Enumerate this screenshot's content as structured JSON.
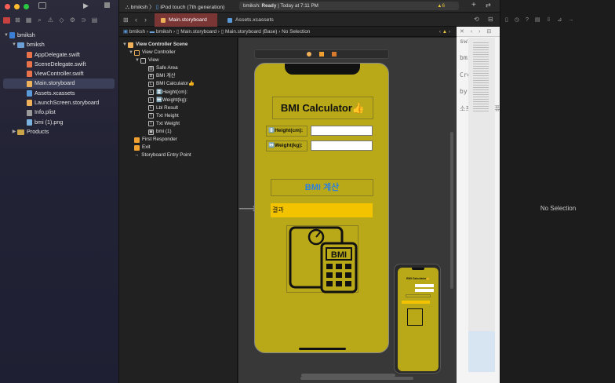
{
  "project": {
    "name": "bmiksh",
    "group": "bmiksh",
    "files": [
      {
        "label": "AppDelegate.swift",
        "kind": "swift"
      },
      {
        "label": "SceneDelegate.swift",
        "kind": "swift"
      },
      {
        "label": "ViewController.swift",
        "kind": "swift"
      },
      {
        "label": "Main.storyboard",
        "kind": "storyboard",
        "selected": true
      },
      {
        "label": "Assets.xcassets",
        "kind": "assets"
      },
      {
        "label": "LaunchScreen.storyboard",
        "kind": "storyboard"
      },
      {
        "label": "Info.plist",
        "kind": "plist"
      },
      {
        "label": "bmi (1).png",
        "kind": "image"
      }
    ],
    "products": "Products"
  },
  "toolbar": {
    "scheme": "bmiksh",
    "device": "iPod touch (7th generation)",
    "status_app": "bmiksh:",
    "status_state": "Ready",
    "status_time": "Today at 7:11 PM",
    "warning_count": "6"
  },
  "tabs": [
    {
      "label": "Main.storyboard",
      "active": true
    },
    {
      "label": "Assets.xcassets",
      "active": false
    }
  ],
  "jumpbar": {
    "items": [
      "bmiksh",
      "bmiksh",
      "Main.storyboard",
      "Main.storyboard (Base)",
      "No Selection"
    ]
  },
  "outline": {
    "scene": "View Controller Scene",
    "controller": "View Controller",
    "view": "View",
    "children": [
      {
        "icon": "▥",
        "label": "Safe Area"
      },
      {
        "icon": "B",
        "label": "BMI 계산"
      },
      {
        "icon": "L",
        "label": "BMI Calculator👍"
      },
      {
        "icon": "L",
        "label": "↕️Height(cm):"
      },
      {
        "icon": "L",
        "label": "↔️Weight(kg):"
      },
      {
        "icon": "L",
        "label": "Lbl Result"
      },
      {
        "icon": "T",
        "label": "Txt Height"
      },
      {
        "icon": "T",
        "label": "Txt Weight"
      },
      {
        "icon": "▣",
        "label": "bmi (1)"
      }
    ],
    "first_responder": "First Responder",
    "exit": "Exit",
    "entry_point": "Storyboard Entry Point"
  },
  "canvas": {
    "title_label": "BMI Calculator👍",
    "height_label": "↕️Height(cm):",
    "weight_label": "↔️Weight(kg):",
    "calc_button": "BMI 계산",
    "result_label": "결과",
    "image_text": "BMI",
    "mini_title": "BMI Calculator👍"
  },
  "source_gutter": {
    "vertical_text": "swift\n\nbmiksh\n\nCreated\n\nby\n\n소프트웨어컴퓨터"
  },
  "inspector": {
    "empty_label": "No Selection"
  },
  "colors": {
    "accent_tab": "#7a3535",
    "phone_background": "#b9a919",
    "result_background": "#f4c300",
    "button_text": "#2b7fe0",
    "warning": "#e9c53d"
  }
}
